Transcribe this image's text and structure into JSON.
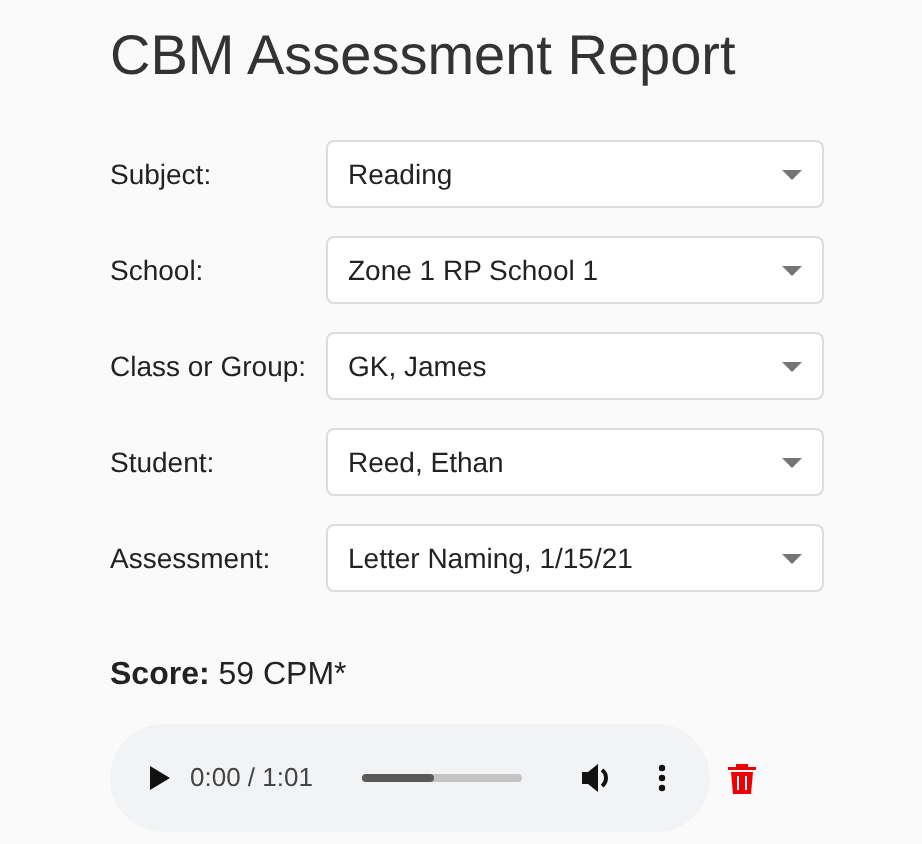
{
  "title": "CBM Assessment Report",
  "fields": [
    {
      "label": "Subject:",
      "value": "Reading"
    },
    {
      "label": "School:",
      "value": "Zone 1 RP School 1"
    },
    {
      "label": "Class or Group:",
      "value": "GK, James"
    },
    {
      "label": "Student:",
      "value": "Reed, Ethan"
    },
    {
      "label": "Assessment:",
      "value": "Letter Naming, 1/15/21"
    }
  ],
  "score": "**Score:** 59 CPM*",
  "audio": {
    "time": "0:00 / 1:01",
    "level": 0.45
  }
}
